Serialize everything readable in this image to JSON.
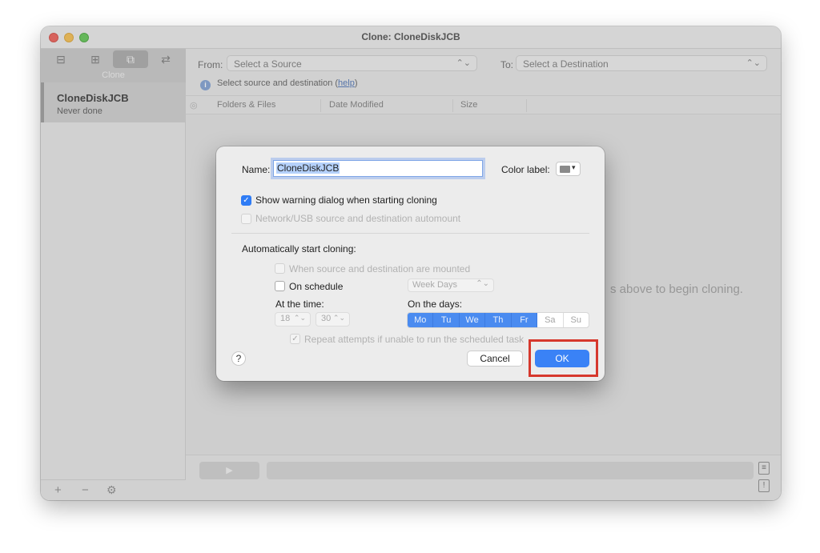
{
  "window": {
    "title": "Clone: CloneDiskJCB"
  },
  "sidebar": {
    "tabs": [
      "backup-icon",
      "archive-icon",
      "clone-icon",
      "sync-icon"
    ],
    "active_tab_label": "Clone",
    "task": {
      "name": "CloneDiskJCB",
      "status": "Never done"
    },
    "bottom": {
      "add": "+",
      "remove": "−",
      "settings_icon": "gear-icon"
    }
  },
  "main": {
    "from_label": "From:",
    "from_placeholder": "Select a Source",
    "to_label": "To:",
    "to_placeholder": "Select a Destination",
    "info_prefix": "Select source and destination (",
    "info_link": "help",
    "info_suffix": ")",
    "columns": [
      "Folders & Files",
      "Date Modified",
      "Size"
    ],
    "hint_fragment": "s above to begin cloning."
  },
  "dialog": {
    "name_label": "Name:",
    "name_value": "CloneDiskJCB",
    "color_label": "Color label:",
    "color_swatch": "#8a8a8a",
    "show_warning": {
      "label": "Show warning dialog when starting cloning",
      "checked": true
    },
    "network_automount": {
      "label": "Network/USB source and destination automount",
      "checked": false,
      "enabled": false
    },
    "auto_start_heading": "Automatically start cloning:",
    "when_mounted": {
      "label": "When source and destination are mounted",
      "checked": false,
      "enabled": false
    },
    "on_schedule": {
      "label": "On schedule",
      "checked": false
    },
    "week_days": "Week Days",
    "at_time_label": "At the time:",
    "hour": "18",
    "minute": "30",
    "on_days_label": "On the days:",
    "days": [
      {
        "label": "Mo",
        "on": true
      },
      {
        "label": "Tu",
        "on": true
      },
      {
        "label": "We",
        "on": true
      },
      {
        "label": "Th",
        "on": true
      },
      {
        "label": "Fr",
        "on": true
      },
      {
        "label": "Sa",
        "on": false
      },
      {
        "label": "Su",
        "on": false
      }
    ],
    "repeat": {
      "label": "Repeat attempts if unable to run the scheduled task",
      "checked": true,
      "enabled": false
    },
    "help": "?",
    "cancel": "Cancel",
    "ok": "OK"
  },
  "colors": {
    "accent": "#3a82f6",
    "highlight": "#d6382d"
  }
}
